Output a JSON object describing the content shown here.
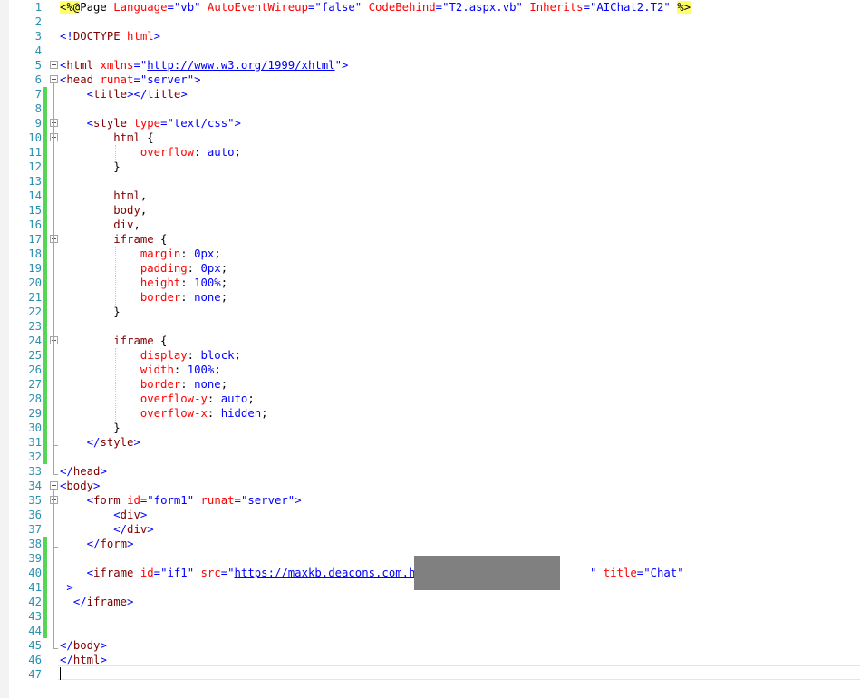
{
  "editor": {
    "lines": [
      {
        "n": "1",
        "parts": [
          [
            "hl",
            "<%@"
          ],
          [
            "",
            "Page "
          ],
          [
            "a",
            "Language"
          ],
          [
            "p",
            "="
          ],
          [
            "v",
            "\"vb\""
          ],
          [
            "",
            " "
          ],
          [
            "a",
            "AutoEventWireup"
          ],
          [
            "p",
            "="
          ],
          [
            "v",
            "\"false\""
          ],
          [
            "",
            " "
          ],
          [
            "a",
            "CodeBehind"
          ],
          [
            "p",
            "="
          ],
          [
            "v",
            "\"T2.aspx.vb\""
          ],
          [
            "",
            " "
          ],
          [
            "a",
            "Inherits"
          ],
          [
            "p",
            "="
          ],
          [
            "v",
            "\"AIChat2.T2\""
          ],
          [
            "",
            " "
          ],
          [
            "hl",
            "%>"
          ]
        ]
      },
      {
        "n": "2",
        "parts": []
      },
      {
        "n": "3",
        "parts": [
          [
            "p",
            "<!"
          ],
          [
            "t",
            "DOCTYPE"
          ],
          [
            "",
            " "
          ],
          [
            "a",
            "html"
          ],
          [
            "p",
            ">"
          ]
        ]
      },
      {
        "n": "4",
        "parts": []
      },
      {
        "n": "5",
        "parts": [
          [
            "p",
            "<"
          ],
          [
            "t",
            "html"
          ],
          [
            "",
            " "
          ],
          [
            "a",
            "xmlns"
          ],
          [
            "p",
            "="
          ],
          [
            "p",
            "\""
          ],
          [
            "u",
            "http://www.w3.org/1999/xhtml"
          ],
          [
            "p",
            "\""
          ],
          [
            "p",
            ">"
          ]
        ]
      },
      {
        "n": "6",
        "parts": [
          [
            "p",
            "<"
          ],
          [
            "t",
            "head"
          ],
          [
            "",
            " "
          ],
          [
            "a",
            "runat"
          ],
          [
            "p",
            "="
          ],
          [
            "v",
            "\"server\""
          ],
          [
            "p",
            ">"
          ]
        ]
      },
      {
        "n": "7",
        "parts": [
          [
            "",
            "    "
          ],
          [
            "p",
            "<"
          ],
          [
            "t",
            "title"
          ],
          [
            "p",
            "></"
          ],
          [
            "t",
            "title"
          ],
          [
            "p",
            ">"
          ]
        ]
      },
      {
        "n": "8",
        "parts": []
      },
      {
        "n": "9",
        "parts": [
          [
            "",
            "    "
          ],
          [
            "p",
            "<"
          ],
          [
            "t",
            "style"
          ],
          [
            "",
            " "
          ],
          [
            "a",
            "type"
          ],
          [
            "p",
            "="
          ],
          [
            "v",
            "\"text/css\""
          ],
          [
            "p",
            ">"
          ]
        ]
      },
      {
        "n": "10",
        "parts": [
          [
            "",
            "        "
          ],
          [
            "t",
            "html"
          ],
          [
            "",
            " {"
          ]
        ]
      },
      {
        "n": "11",
        "parts": [
          [
            "",
            "            "
          ],
          [
            "a",
            "overflow"
          ],
          [
            "",
            ": "
          ],
          [
            "v",
            "auto"
          ],
          [
            "",
            ";"
          ]
        ]
      },
      {
        "n": "12",
        "parts": [
          [
            "",
            "        }"
          ]
        ]
      },
      {
        "n": "13",
        "parts": []
      },
      {
        "n": "14",
        "parts": [
          [
            "",
            "        "
          ],
          [
            "t",
            "html"
          ],
          [
            "",
            ","
          ]
        ]
      },
      {
        "n": "15",
        "parts": [
          [
            "",
            "        "
          ],
          [
            "t",
            "body"
          ],
          [
            "",
            ","
          ]
        ]
      },
      {
        "n": "16",
        "parts": [
          [
            "",
            "        "
          ],
          [
            "t",
            "div"
          ],
          [
            "",
            ","
          ]
        ]
      },
      {
        "n": "17",
        "parts": [
          [
            "",
            "        "
          ],
          [
            "t",
            "iframe"
          ],
          [
            "",
            " {"
          ]
        ]
      },
      {
        "n": "18",
        "parts": [
          [
            "",
            "            "
          ],
          [
            "a",
            "margin"
          ],
          [
            "",
            ": "
          ],
          [
            "v",
            "0px"
          ],
          [
            "",
            ";"
          ]
        ]
      },
      {
        "n": "19",
        "parts": [
          [
            "",
            "            "
          ],
          [
            "a",
            "padding"
          ],
          [
            "",
            ": "
          ],
          [
            "v",
            "0px"
          ],
          [
            "",
            ";"
          ]
        ]
      },
      {
        "n": "20",
        "parts": [
          [
            "",
            "            "
          ],
          [
            "a",
            "height"
          ],
          [
            "",
            ": "
          ],
          [
            "v",
            "100%"
          ],
          [
            "",
            ";"
          ]
        ]
      },
      {
        "n": "21",
        "parts": [
          [
            "",
            "            "
          ],
          [
            "a",
            "border"
          ],
          [
            "",
            ": "
          ],
          [
            "v",
            "none"
          ],
          [
            "",
            ";"
          ]
        ]
      },
      {
        "n": "22",
        "parts": [
          [
            "",
            "        }"
          ]
        ]
      },
      {
        "n": "23",
        "parts": []
      },
      {
        "n": "24",
        "parts": [
          [
            "",
            "        "
          ],
          [
            "t",
            "iframe"
          ],
          [
            "",
            " {"
          ]
        ]
      },
      {
        "n": "25",
        "parts": [
          [
            "",
            "            "
          ],
          [
            "a",
            "display"
          ],
          [
            "",
            ": "
          ],
          [
            "v",
            "block"
          ],
          [
            "",
            ";"
          ]
        ]
      },
      {
        "n": "26",
        "parts": [
          [
            "",
            "            "
          ],
          [
            "a",
            "width"
          ],
          [
            "",
            ": "
          ],
          [
            "v",
            "100%"
          ],
          [
            "",
            ";"
          ]
        ]
      },
      {
        "n": "27",
        "parts": [
          [
            "",
            "            "
          ],
          [
            "a",
            "border"
          ],
          [
            "",
            ": "
          ],
          [
            "v",
            "none"
          ],
          [
            "",
            ";"
          ]
        ]
      },
      {
        "n": "28",
        "parts": [
          [
            "",
            "            "
          ],
          [
            "a",
            "overflow-y"
          ],
          [
            "",
            ": "
          ],
          [
            "v",
            "auto"
          ],
          [
            "",
            ";"
          ]
        ]
      },
      {
        "n": "29",
        "parts": [
          [
            "",
            "            "
          ],
          [
            "a",
            "overflow-x"
          ],
          [
            "",
            ": "
          ],
          [
            "v",
            "hidden"
          ],
          [
            "",
            ";"
          ]
        ]
      },
      {
        "n": "30",
        "parts": [
          [
            "",
            "        }"
          ]
        ]
      },
      {
        "n": "31",
        "parts": [
          [
            "",
            "    "
          ],
          [
            "p",
            "</"
          ],
          [
            "t",
            "style"
          ],
          [
            "p",
            ">"
          ]
        ]
      },
      {
        "n": "32",
        "parts": []
      },
      {
        "n": "33",
        "parts": [
          [
            "p",
            "</"
          ],
          [
            "t",
            "head"
          ],
          [
            "p",
            ">"
          ]
        ]
      },
      {
        "n": "34",
        "parts": [
          [
            "p",
            "<"
          ],
          [
            "t",
            "body"
          ],
          [
            "p",
            ">"
          ]
        ]
      },
      {
        "n": "35",
        "parts": [
          [
            "",
            "    "
          ],
          [
            "p",
            "<"
          ],
          [
            "t",
            "form"
          ],
          [
            "",
            " "
          ],
          [
            "a",
            "id"
          ],
          [
            "p",
            "="
          ],
          [
            "v",
            "\"form1\""
          ],
          [
            "",
            " "
          ],
          [
            "a",
            "runat"
          ],
          [
            "p",
            "="
          ],
          [
            "v",
            "\"server\""
          ],
          [
            "p",
            ">"
          ]
        ]
      },
      {
        "n": "36",
        "parts": [
          [
            "",
            "        "
          ],
          [
            "p",
            "<"
          ],
          [
            "t",
            "div"
          ],
          [
            "p",
            ">"
          ]
        ]
      },
      {
        "n": "37",
        "parts": [
          [
            "",
            "        "
          ],
          [
            "p",
            "</"
          ],
          [
            "t",
            "div"
          ],
          [
            "p",
            ">"
          ]
        ]
      },
      {
        "n": "38",
        "parts": [
          [
            "",
            "    "
          ],
          [
            "p",
            "</"
          ],
          [
            "t",
            "form"
          ],
          [
            "p",
            ">"
          ]
        ]
      },
      {
        "n": "39",
        "parts": []
      },
      {
        "n": "40",
        "parts": [
          [
            "",
            "    "
          ],
          [
            "p",
            "<"
          ],
          [
            "t",
            "iframe"
          ],
          [
            "",
            " "
          ],
          [
            "a",
            "id"
          ],
          [
            "p",
            "="
          ],
          [
            "v",
            "\"if1\""
          ],
          [
            "",
            " "
          ],
          [
            "a",
            "src"
          ],
          [
            "p",
            "="
          ],
          [
            "p",
            "\""
          ],
          [
            "u",
            "https://maxkb.deacons.com.hk/u"
          ],
          [
            "",
            "                       "
          ],
          [
            "p",
            "\""
          ],
          [
            "",
            " "
          ],
          [
            "a",
            "title"
          ],
          [
            "p",
            "="
          ],
          [
            "v",
            "\"Chat\""
          ]
        ]
      },
      {
        "n": "41",
        "parts": [
          [
            "",
            ""
          ],
          [
            "p",
            " >"
          ]
        ]
      },
      {
        "n": "42",
        "parts": [
          [
            "",
            "  "
          ],
          [
            "p",
            "</"
          ],
          [
            "t",
            "iframe"
          ],
          [
            "p",
            ">"
          ]
        ]
      },
      {
        "n": "43",
        "parts": []
      },
      {
        "n": "44",
        "parts": []
      },
      {
        "n": "45",
        "parts": [
          [
            "p",
            "</"
          ],
          [
            "t",
            "body"
          ],
          [
            "p",
            ">"
          ]
        ]
      },
      {
        "n": "46",
        "parts": [
          [
            "p",
            "</"
          ],
          [
            "t",
            "html"
          ],
          [
            "p",
            ">"
          ]
        ]
      },
      {
        "n": "47",
        "parts": []
      }
    ]
  }
}
